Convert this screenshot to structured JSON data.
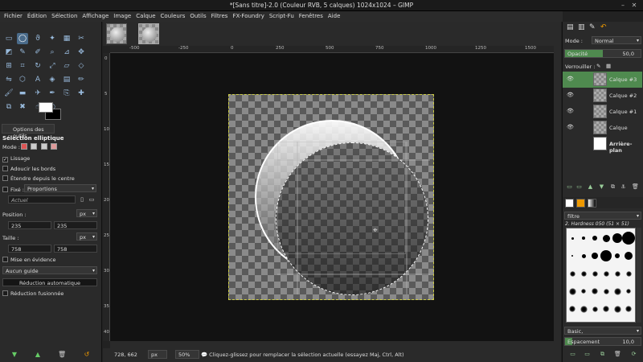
{
  "window": {
    "title": "*[Sans titre]-2.0 (Couleur RVB, 5 calques) 1024x1024 – GIMP"
  },
  "menubar": [
    "Fichier",
    "Édition",
    "Sélection",
    "Affichage",
    "Image",
    "Calque",
    "Couleurs",
    "Outils",
    "Filtres",
    "FX-Foundry",
    "Script-Fu",
    "Fenêtres",
    "Aide"
  ],
  "tool_options": {
    "tab_label": "Options des outils",
    "title": "Sélection elliptique",
    "mode_label": "Mode :",
    "antialias_label": "Lissage",
    "antialias_checked": true,
    "feather_label": "Adoucir les bords",
    "expand_center_label": "Étendre depuis le centre",
    "fixed_label": "Fixé :",
    "fixed_value": "Proportions",
    "current_value": "Actuel",
    "position_label": "Position :",
    "position_unit": "px",
    "position_x": "235",
    "position_y": "235",
    "size_label": "Taille :",
    "size_unit": "px",
    "size_w": "758",
    "size_h": "758",
    "highlight_label": "Mise en évidence",
    "guides_value": "Aucun guide",
    "auto_shrink_label": "Réduction automatique",
    "shrink_merged_label": "Réduction fusionnée"
  },
  "rulers": {
    "top": [
      "-500",
      "-250",
      "0",
      "250",
      "500",
      "750",
      "1000",
      "1250",
      "1500"
    ],
    "left": [
      "0",
      "5",
      "10",
      "15",
      "20",
      "25",
      "30",
      "35",
      "40"
    ]
  },
  "status": {
    "coords": "728, 662",
    "unit": "px",
    "zoom": "50%",
    "message": "Cliquez-glissez pour remplacer la sélection actuelle (essayez Maj, Ctrl, Alt)"
  },
  "layers_panel": {
    "mode_label": "Mode :",
    "mode_value": "Normal",
    "opacity_label": "Opacité",
    "opacity_value": "50,0",
    "opacity_fraction": 0.5,
    "lock_label": "Verrouiller :",
    "layers": [
      {
        "name": "Calque #3",
        "selected": true,
        "visible": true
      },
      {
        "name": "Calque #2",
        "selected": false,
        "visible": true
      },
      {
        "name": "Calque #1",
        "selected": false,
        "visible": true
      },
      {
        "name": "Calque",
        "selected": false,
        "visible": true
      },
      {
        "name": "Arrière-plan",
        "selected": false,
        "visible": false
      }
    ]
  },
  "brushes_panel": {
    "filter_value": "filtre",
    "brush_name": "2. Hardness 050 (51 × 51)",
    "preset_value": "Basic,",
    "spacing_label": "Espacement",
    "spacing_value": "10,0",
    "spacing_fraction": 0.1
  },
  "colors": {
    "foreground": "#ffffff",
    "background": "#000000",
    "accent_green": "#4f8a4f"
  }
}
